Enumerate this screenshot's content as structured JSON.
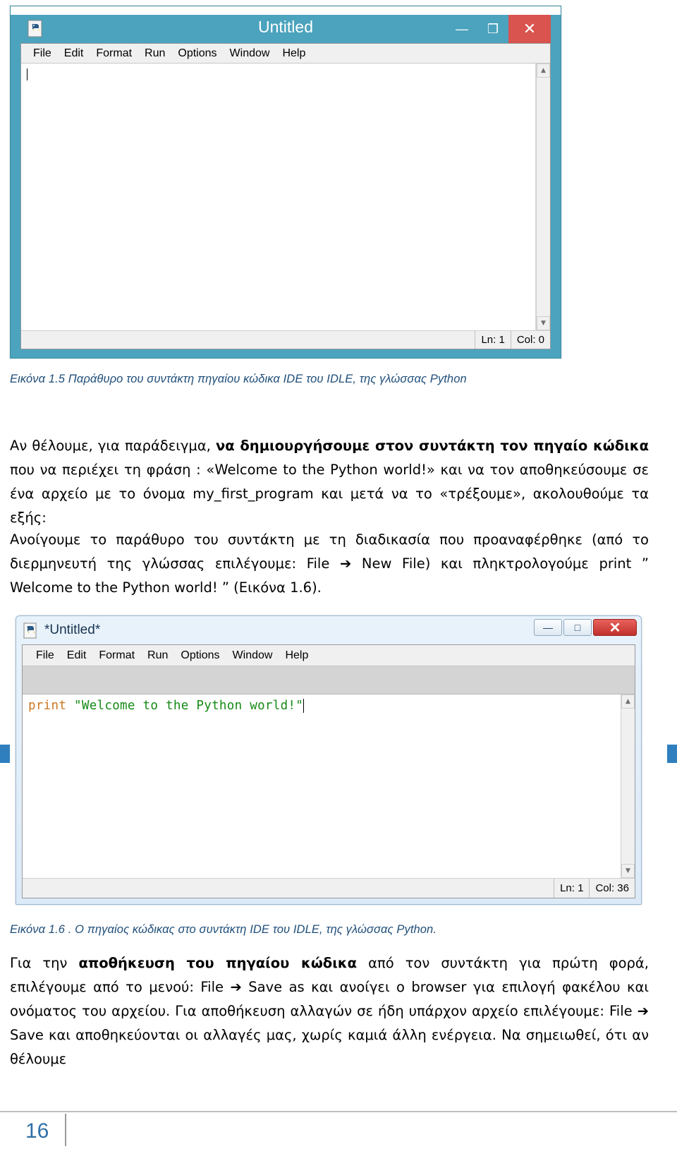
{
  "window1": {
    "title": "Untitled",
    "icon": "python-idle-icon",
    "buttons": {
      "minimize": "—",
      "maximize": "❐",
      "close": "✕"
    },
    "menu": [
      "File",
      "Edit",
      "Format",
      "Run",
      "Options",
      "Window",
      "Help"
    ],
    "editor_text": "",
    "status": {
      "line": "Ln: 1",
      "col": "Col: 0"
    },
    "scroll": {
      "up": "▲",
      "down": "▼"
    },
    "titlebar_color": "#4ba3bd",
    "close_color": "#d9534f"
  },
  "caption1": "Εικόνα 1.5 Παράθυρο του συντάκτη πηγαίου κώδικα IDE  του IDLE, της γλώσσας Python",
  "paragraph1": {
    "part1": "Αν θέλουμε, για παράδειγμα, ",
    "bold": "να δημιουργήσουμε στον συντάκτη τον πηγαίο κώδικα",
    "part2": " που να περιέχει τη φράση : «Welcome to the Python world!» και να τον αποθηκεύσουμε σε ένα αρχείο με το όνομα my_first_program και μετά να το «τρέξουμε», ακολουθούμε τα εξής:"
  },
  "paragraph2": "Ανοίγουμε το παράθυρο του συντάκτη με τη διαδικασία που προαναφέρθηκε (από το διερμηνευτή της γλώσσας επιλέγουμε: File ➔ New File) και πληκτρολογούμε print ” Welcome to the Python world! ” (Εικόνα 1.6).",
  "window2": {
    "title": "*Untitled*",
    "icon": "python-idle-icon",
    "buttons": {
      "minimize": "—",
      "maximize": "□",
      "close": "✕"
    },
    "menu": [
      "File",
      "Edit",
      "Format",
      "Run",
      "Options",
      "Window",
      "Help"
    ],
    "code": {
      "keyword": "print",
      "space": " ",
      "string": "\"Welcome to the Python world!\"",
      "keyword_color": "#cc7722",
      "string_color": "#158a15"
    },
    "status": {
      "line": "Ln: 1",
      "col": "Col: 36"
    },
    "scroll": {
      "up": "▲",
      "down": "▼"
    }
  },
  "caption2": "Εικόνα 1.6 . Ο πηγαίος κώδικας στο συντάκτη IDE  του IDLE, της γλώσσας Python.",
  "paragraph3": {
    "part1": "Για την ",
    "bold": "αποθήκευση του πηγαίου κώδικα",
    "part2": " από τον συντάκτη για πρώτη φορά, επιλέγουμε από το μενού: File ➔ Save as και ανοίγει ο browser για επιλογή φακέλου και ονόματος του αρχείου. Για αποθήκευση αλλαγών σε ήδη υπάρχον αρχείο επιλέγουμε: File ➔ Save και αποθηκεύονται οι αλλαγές μας, χωρίς καμιά άλλη ενέργεια. Να σημειωθεί, ότι αν θέλουμε"
  },
  "footer": {
    "page_number": "16"
  }
}
